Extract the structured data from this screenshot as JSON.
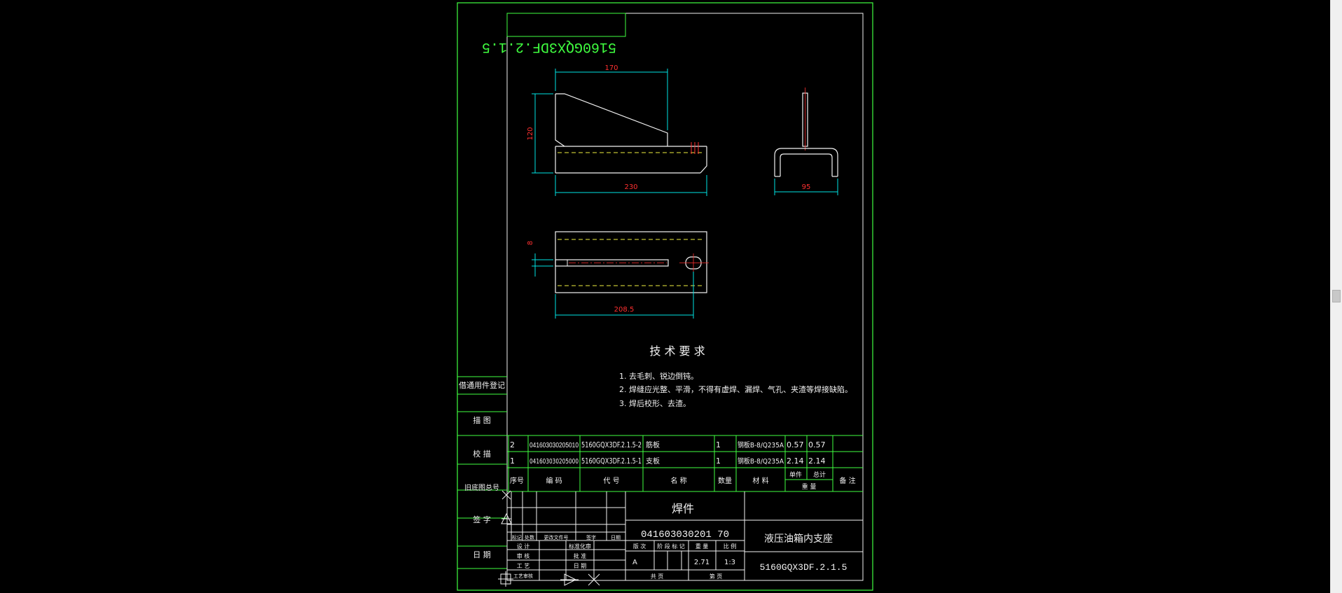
{
  "drawing": {
    "code_mirrored": "5160GQX3DF.2.1.5",
    "dims": {
      "top_width": "170",
      "height": "120",
      "base_width": "230",
      "side_width": "95",
      "small_vertical": "8",
      "slot_length": "208.5"
    },
    "tech_title": "技 术 要 求",
    "tech_items": [
      "1. 去毛刺、锐边倒钝。",
      "2. 焊缝应光整、平滑，不得有虚焊、漏焊、气孔、夹渣等焊接缺陷。",
      "3. 焊后校形、去渣。"
    ]
  },
  "left_strip": {
    "labels": [
      "借通用件登记",
      "描 图",
      "校 描",
      "旧底图总号",
      "签 字",
      "日 期"
    ]
  },
  "bom": {
    "rows": [
      {
        "idx": "2",
        "code": "041603030205010",
        "part": "5160GQX3DF.2.1.5-2",
        "name": "筋板",
        "qty": "1",
        "material": "钢板B-8/Q235A",
        "unit": "0.57",
        "total": "0.57"
      },
      {
        "idx": "1",
        "code": "041603030205000",
        "part": "5160GQX3DF.2.1.5-1",
        "name": "支板",
        "qty": "1",
        "material": "钢板B-8/Q235A",
        "unit": "2.14",
        "total": "2.14"
      }
    ],
    "header": {
      "idx": "序号",
      "code": "编 码",
      "part": "代 号",
      "name": "名 称",
      "qty": "数量",
      "material": "材 料",
      "unit": "单件",
      "total": "总计",
      "weight": "重 量",
      "remark": "备 注"
    }
  },
  "title_block": {
    "part_type": "焊件",
    "drawing_number": "041603030201 70",
    "name": "液压油箱内支座",
    "code": "5160GQX3DF.2.1.5",
    "rev_header": [
      "标记",
      "处数",
      "更改文件号",
      "签字",
      "日期"
    ],
    "roles": [
      "设 计",
      "审 核",
      "工 艺",
      "工艺审核"
    ],
    "roles2": [
      "标准化审",
      "批 准",
      "日 期",
      ""
    ],
    "stage_headers": [
      "版 次",
      "阶 段 标 记",
      "重 量",
      "比 例"
    ],
    "stage_values": [
      "A",
      "",
      "2.71",
      "1:3"
    ],
    "sheets": [
      "共 页",
      "第 页"
    ]
  }
}
